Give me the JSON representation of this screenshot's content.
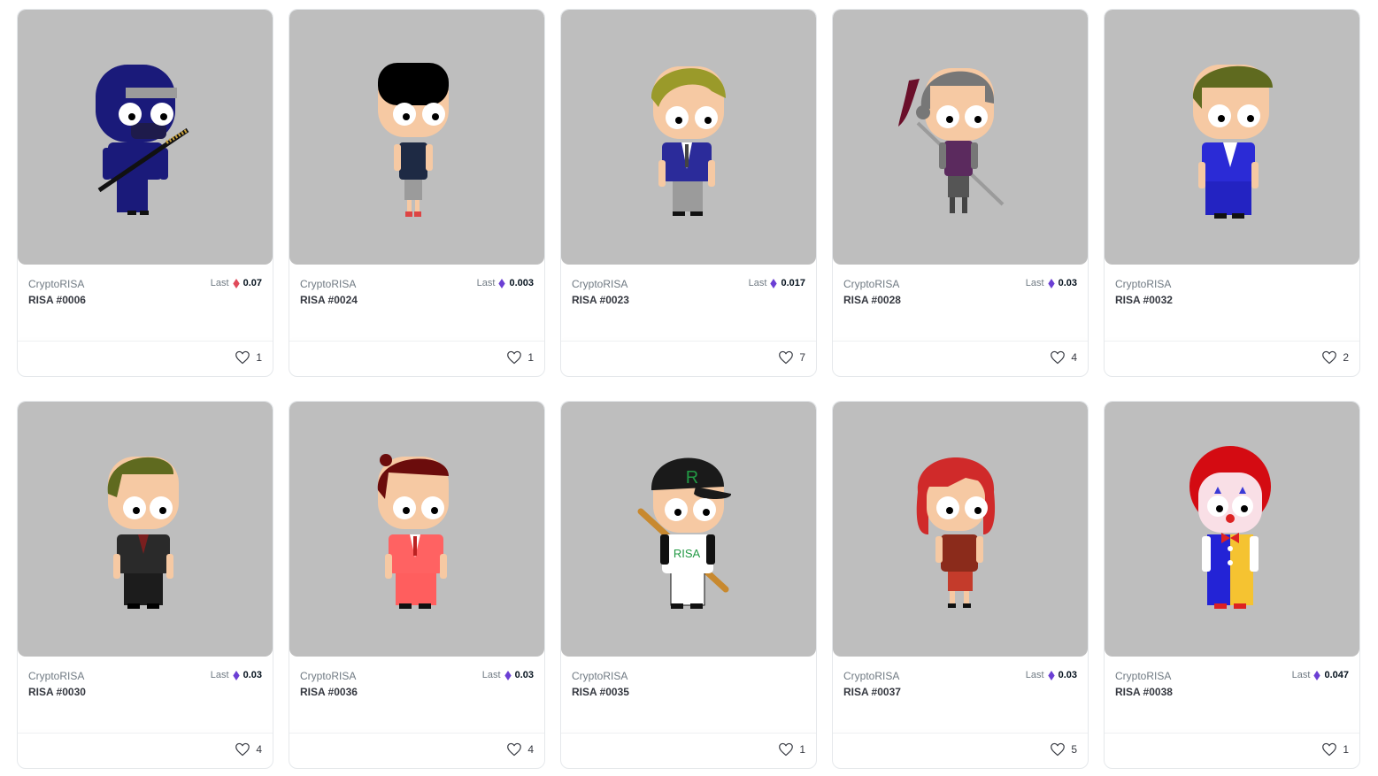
{
  "colors": {
    "card_border": "#e5e8eb",
    "image_bg": "#bebebe",
    "eth_purple": "#6b3fd4",
    "eth_red": "#e04a5a",
    "text_muted": "#707a83",
    "text_dark": "#353840"
  },
  "cards": [
    {
      "collection": "CryptoRISA",
      "name": "RISA #0006",
      "last_label": "Last",
      "last_price": "0.07",
      "price_icon": "eth-red-icon",
      "likes": "1",
      "character": "ninja"
    },
    {
      "collection": "CryptoRISA",
      "name": "RISA #0024",
      "last_label": "Last",
      "last_price": "0.003",
      "price_icon": "eth-icon",
      "likes": "1",
      "character": "casual"
    },
    {
      "collection": "CryptoRISA",
      "name": "RISA #0023",
      "last_label": "Last",
      "last_price": "0.017",
      "price_icon": "eth-icon",
      "likes": "7",
      "character": "blonde-suit"
    },
    {
      "collection": "CryptoRISA",
      "name": "RISA #0028",
      "last_label": "Last",
      "last_price": "0.03",
      "price_icon": "eth-icon",
      "likes": "4",
      "character": "knight"
    },
    {
      "collection": "CryptoRISA",
      "name": "RISA #0032",
      "last_label": "",
      "last_price": "",
      "price_icon": "",
      "likes": "2",
      "character": "blue-suit"
    },
    {
      "collection": "CryptoRISA",
      "name": "RISA #0030",
      "last_label": "Last",
      "last_price": "0.03",
      "price_icon": "eth-icon",
      "likes": "4",
      "character": "black-suit"
    },
    {
      "collection": "CryptoRISA",
      "name": "RISA #0036",
      "last_label": "Last",
      "last_price": "0.03",
      "price_icon": "eth-icon",
      "likes": "4",
      "character": "red-suit"
    },
    {
      "collection": "CryptoRISA",
      "name": "RISA #0035",
      "last_label": "",
      "last_price": "",
      "price_icon": "",
      "likes": "1",
      "character": "baseball",
      "cap_letter": "R",
      "jersey_text": "RISA"
    },
    {
      "collection": "CryptoRISA",
      "name": "RISA #0037",
      "last_label": "Last",
      "last_price": "0.03",
      "price_icon": "eth-icon",
      "likes": "5",
      "character": "redhead"
    },
    {
      "collection": "CryptoRISA",
      "name": "RISA #0038",
      "last_label": "Last",
      "last_price": "0.047",
      "price_icon": "eth-icon",
      "likes": "1",
      "character": "clown"
    }
  ]
}
